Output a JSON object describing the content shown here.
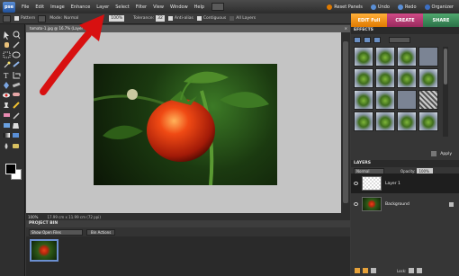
{
  "app": {
    "logo_text": "pse"
  },
  "menu": [
    "File",
    "Edit",
    "Image",
    "Enhance",
    "Layer",
    "Select",
    "Filter",
    "View",
    "Window",
    "Help"
  ],
  "top_right": {
    "reset_panels": "Reset Panels",
    "undo": "Undo",
    "redo": "Redo",
    "organizer": "Organizer"
  },
  "options_bar": {
    "pattern_label": "Pattern",
    "mode_label": "Mode:",
    "mode_value": "Normal",
    "opacity_value": "100%",
    "tolerance_label": "Tolerance:",
    "tolerance_value": "32",
    "anti_alias": "Anti-alias",
    "contiguous": "Contiguous",
    "all_layers": "All Layers"
  },
  "tabs": {
    "edit": "EDIT Full",
    "create": "CREATE",
    "share": "SHARE"
  },
  "document": {
    "tab_title": "tomato-1.jpg @ 16.7% (Layer 1, RGB/8)",
    "close": "×",
    "zoom": "100%",
    "info": "17.99 cm x 11.99 cm (72 ppi)"
  },
  "project_bin": {
    "title": "PROJECT BIN",
    "select_value": "Show Open Files",
    "actions": "Bin Actions"
  },
  "effects": {
    "title": "EFFECTS",
    "apply": "Apply"
  },
  "layers": {
    "title": "LAYERS",
    "blend": "Normal",
    "opacity_label": "Opacity:",
    "opacity_value": "100%",
    "items": [
      {
        "name": "Layer 1"
      },
      {
        "name": "Background"
      }
    ],
    "lock_label": "Lock:"
  },
  "colors": {
    "accent": "#e07a00",
    "annotation_arrow": "#d81010"
  }
}
